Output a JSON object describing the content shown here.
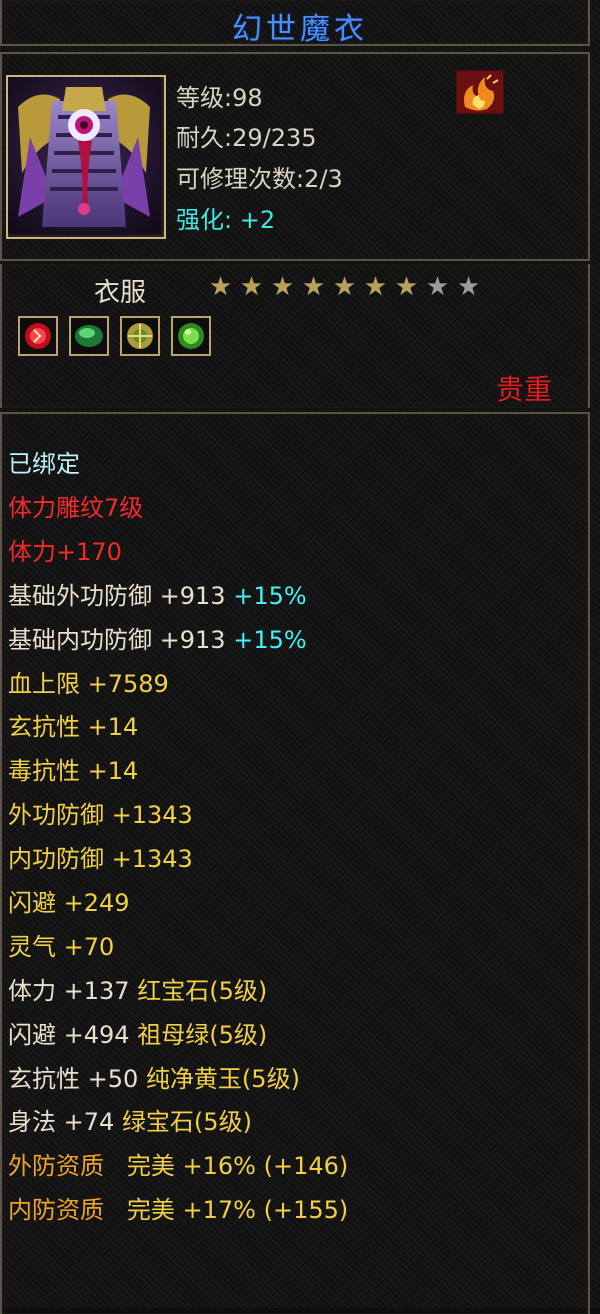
{
  "item": {
    "name": "幻世魔衣",
    "level_text": "等级:98",
    "durability_text": "耐久:29/235",
    "repair_text": "可修理次数:2/3",
    "enhance_label": "强化:",
    "enhance_value": "+2",
    "type": "衣服",
    "stars_total": 9,
    "stars_filled": 7,
    "rarity": "贵重",
    "gem_icons": [
      "red-gem-icon",
      "green-jade-icon",
      "yellow-jade-icon",
      "emerald-icon"
    ],
    "set_icon": "flame-set-icon"
  },
  "attributes": {
    "bound": "已绑定",
    "engrave": "体力雕纹7级",
    "engrave_bonus": "体力+170",
    "base_ext_def": {
      "label": "基础外功防御",
      "value": "+913",
      "pct": "+15%"
    },
    "base_int_def": {
      "label": "基础内功防御",
      "value": "+913",
      "pct": "+15%"
    },
    "hp": {
      "label": "血上限",
      "value": "+7589"
    },
    "xuan_res": {
      "label": "玄抗性",
      "value": "+14"
    },
    "poison_res": {
      "label": "毒抗性",
      "value": "+14"
    },
    "ext_def": {
      "label": "外功防御",
      "value": "+1343"
    },
    "int_def": {
      "label": "内功防御",
      "value": "+1343"
    },
    "dodge": {
      "label": "闪避",
      "value": "+249"
    },
    "spirit": {
      "label": "灵气",
      "value": "+70"
    },
    "gem1": {
      "label": "体力",
      "value": "+137",
      "gem": "红宝石(5级)"
    },
    "gem2": {
      "label": "闪避",
      "value": "+494",
      "gem": "祖母绿(5级)"
    },
    "gem3": {
      "label": "玄抗性",
      "value": "+50",
      "gem": "纯净黄玉(5级)"
    },
    "gem4": {
      "label": "身法",
      "value": "+74",
      "gem": "绿宝石(5级)"
    },
    "q_ext": {
      "label": "外防资质",
      "grade": "完美",
      "pct": "+16%",
      "bonus": "(+146)"
    },
    "q_int": {
      "label": "内防资质",
      "grade": "完美",
      "pct": "+17%",
      "bonus": "(+155)"
    }
  },
  "colors": {
    "title": "#4d8ff0",
    "rarity": "#e21c1c",
    "enhance": "#41e6e2",
    "gem_text": "#f2d046",
    "quality_text": "#f0a324"
  }
}
